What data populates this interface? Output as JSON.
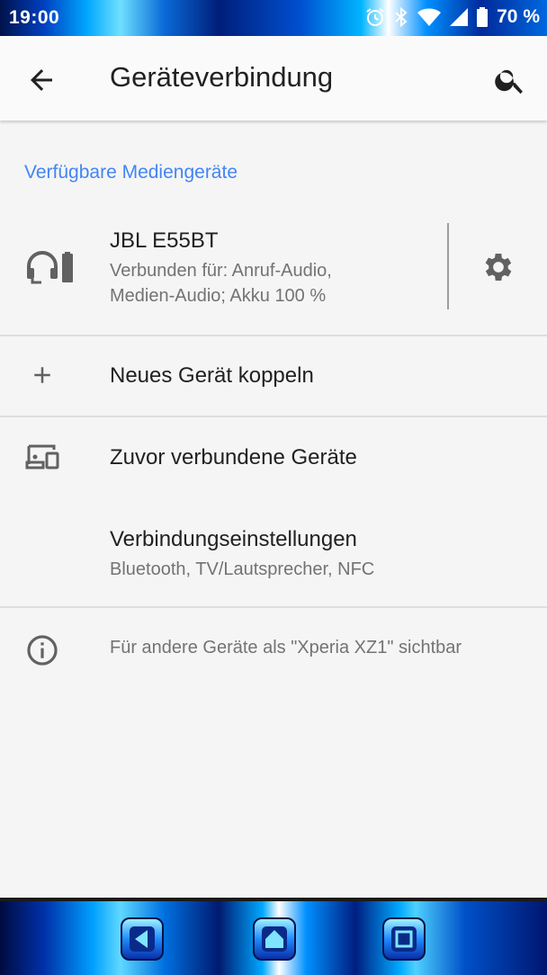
{
  "status_bar": {
    "time": "19:00",
    "battery_percent": "70 %",
    "icons": [
      "alarm-icon",
      "bluetooth-icon",
      "wifi-icon",
      "signal-icon",
      "battery-icon"
    ]
  },
  "app_bar": {
    "title": "Geräteverbindung",
    "back_icon": "arrow-back-icon",
    "search_icon": "search-icon"
  },
  "section_header": "Verfügbare Mediengeräte",
  "device": {
    "name": "JBL E55BT",
    "status_line1": "Verbunden für: Anruf-Audio,",
    "status_line2": "Medien-Audio; Akku 100 %",
    "icon": "headset-battery-icon",
    "settings_icon": "gear-icon"
  },
  "pair_new": {
    "label": "Neues Gerät koppeln",
    "icon": "plus-icon"
  },
  "previous": {
    "label": "Zuvor verbundene Geräte",
    "icon": "devices-icon"
  },
  "connection_settings": {
    "label": "Verbindungseinstellungen",
    "sub": "Bluetooth, TV/Lautsprecher, NFC"
  },
  "info": {
    "text": "Für andere Geräte als \"Xperia XZ1\" sichtbar",
    "icon": "info-icon"
  },
  "nav_bar": {
    "buttons": [
      "back-nav-icon",
      "home-nav-icon",
      "recents-nav-icon"
    ]
  },
  "colors": {
    "accent": "#4285f4",
    "text_primary": "#212121",
    "text_secondary": "#737373",
    "background": "#f5f5f5"
  }
}
